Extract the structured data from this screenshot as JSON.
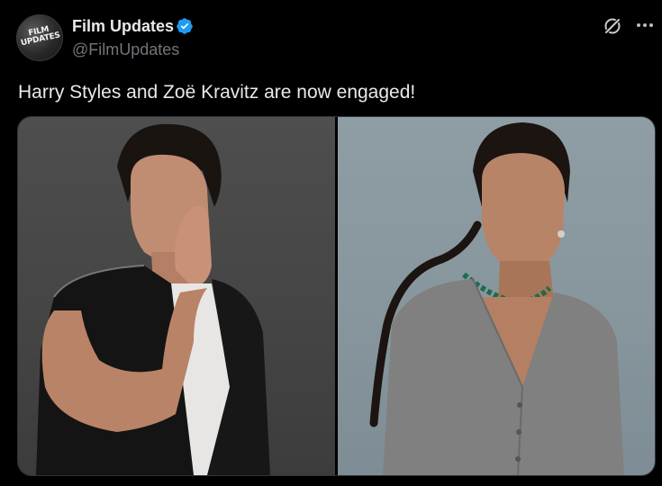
{
  "author": {
    "display_name": "Film Updates",
    "handle": "@FilmUpdates",
    "avatar_text": "FILM UPDATES",
    "verified": true,
    "verified_color": "#1d9bf0"
  },
  "post": {
    "text": "Harry Styles and Zoë Kravitz are now engaged!"
  },
  "media": {
    "count": 2
  },
  "icons": {
    "grok": "grok-icon",
    "more": "more-dots-icon",
    "verified": "verified-badge-icon"
  },
  "colors": {
    "background": "#000000",
    "text_primary": "#e7e9ea",
    "text_secondary": "#71767b",
    "border": "#2f3336"
  }
}
